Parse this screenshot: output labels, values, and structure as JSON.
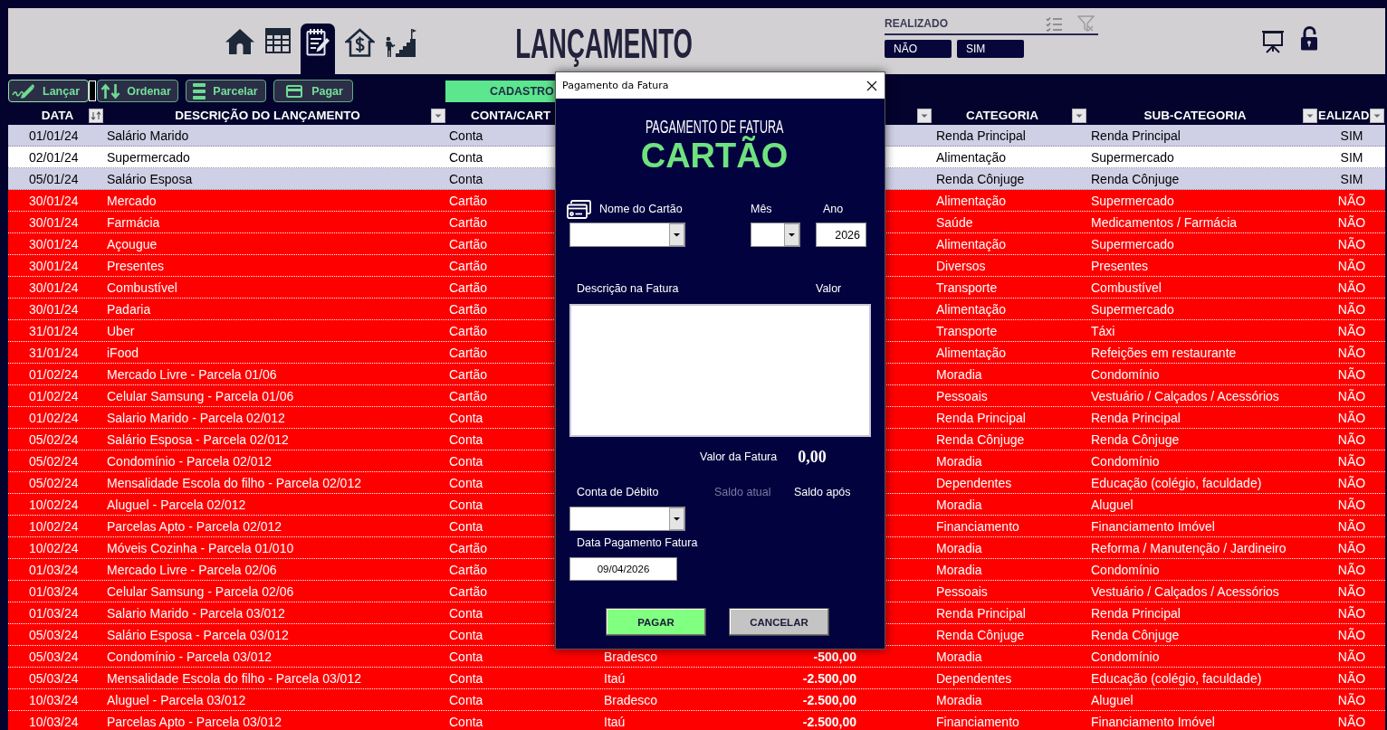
{
  "header": {
    "nav_tabs": [
      {
        "kind": "home",
        "selected": false
      },
      {
        "kind": "grid",
        "selected": false
      },
      {
        "kind": "notepad",
        "selected": true
      },
      {
        "kind": "house-dollar",
        "selected": false
      },
      {
        "kind": "stairs",
        "selected": false
      }
    ],
    "title": "LANÇAMENTO",
    "filter_panel": {
      "title": "REALIZADO",
      "options": [
        "NÃO",
        "SIM"
      ]
    }
  },
  "toolbar": {
    "buttons": [
      {
        "label": "Lançar",
        "kind": "signature"
      },
      {
        "label": "Ordenar",
        "kind": "sort"
      },
      {
        "label": "Parcelar",
        "kind": "stack"
      },
      {
        "label": "Pagar",
        "kind": "card"
      }
    ],
    "register_button": "CADASTRO"
  },
  "table": {
    "columns": [
      {
        "label": "DATA",
        "kind": "sort"
      },
      {
        "label": "DESCRIÇÃO DO LANÇAMENTO",
        "kind": "filter"
      },
      {
        "label": "CONTA/CART",
        "kind": "plain"
      },
      {
        "kind": "filter"
      },
      {
        "label": "CATEGORIA",
        "kind": "filter"
      },
      {
        "label": "SUB-CATEGORIA",
        "kind": "filter"
      },
      {
        "label": "EALIZAD",
        "kind": "filter"
      }
    ],
    "rows": [
      {
        "date": "01/01/24",
        "description": "Salário Marido",
        "column_3": "Conta",
        "category": "Renda Principal",
        "subcategory": "Renda Principal",
        "column_8": "SIM",
        "done": true
      },
      {
        "date": "02/01/24",
        "description": "Supermercado",
        "column_3": "Conta",
        "category": "Alimentação",
        "subcategory": "Supermercado",
        "column_8": "SIM",
        "done": true
      },
      {
        "date": "05/01/24",
        "description": "Salário Esposa",
        "column_3": "Conta",
        "category": "Renda Cônjuge",
        "subcategory": "Renda Cônjuge",
        "column_8": "SIM",
        "done": true
      },
      {
        "date": "30/01/24",
        "description": "Mercado",
        "column_3": "Cartão",
        "category": "Alimentação",
        "subcategory": "Supermercado",
        "column_8": "NÃO",
        "done": false
      },
      {
        "date": "30/01/24",
        "description": "Farmácia",
        "column_3": "Cartão",
        "category": "Saúde",
        "subcategory": "Medicamentos / Farmácia",
        "column_8": "NÃO",
        "done": false
      },
      {
        "date": "30/01/24",
        "description": "Açougue",
        "column_3": "Cartão",
        "category": "Alimentação",
        "subcategory": "Supermercado",
        "column_8": "NÃO",
        "done": false
      },
      {
        "date": "30/01/24",
        "description": "Presentes",
        "column_3": "Cartão",
        "category": "Diversos",
        "subcategory": "Presentes",
        "column_8": "NÃO",
        "done": false
      },
      {
        "date": "30/01/24",
        "description": "Combustível",
        "column_3": "Cartão",
        "category": "Transporte",
        "subcategory": "Combustível",
        "column_8": "NÃO",
        "done": false
      },
      {
        "date": "30/01/24",
        "description": "Padaria",
        "column_3": "Cartão",
        "category": "Alimentação",
        "subcategory": "Supermercado",
        "column_8": "NÃO",
        "done": false
      },
      {
        "date": "31/01/24",
        "description": "Uber",
        "column_3": "Cartão",
        "category": "Transporte",
        "subcategory": "Táxi",
        "column_8": "NÃO",
        "done": false
      },
      {
        "date": "31/01/24",
        "description": "iFood",
        "column_3": "Cartão",
        "category": "Alimentação",
        "subcategory": "Refeições em restaurante",
        "column_8": "NÃO",
        "done": false
      },
      {
        "date": "01/02/24",
        "description": "Mercado Livre - Parcela 01/06",
        "column_3": "Cartão",
        "category": "Moradia",
        "subcategory": "Condomínio",
        "column_8": "NÃO",
        "done": false
      },
      {
        "date": "01/02/24",
        "description": "Celular Samsung - Parcela 01/06",
        "column_3": "Cartão",
        "category": "Pessoais",
        "subcategory": "Vestuário / Calçados / Acessórios",
        "column_8": "NÃO",
        "done": false
      },
      {
        "date": "01/02/24",
        "description": "Salario Marido - Parcela 02/012",
        "column_3": "Conta",
        "category": "Renda Principal",
        "subcategory": "Renda Principal",
        "column_8": "NÃO",
        "done": false
      },
      {
        "date": "05/02/24",
        "description": "Salário Esposa - Parcela 02/012",
        "column_3": "Conta",
        "category": "Renda Cônjuge",
        "subcategory": "Renda Cônjuge",
        "column_8": "NÃO",
        "done": false
      },
      {
        "date": "05/02/24",
        "description": "Condomínio - Parcela 02/012",
        "column_3": "Conta",
        "category": "Moradia",
        "subcategory": "Condomínio",
        "column_8": "NÃO",
        "done": false
      },
      {
        "date": "05/02/24",
        "description": "Mensalidade Escola do filho - Parcela 02/012",
        "column_3": "Conta",
        "category": "Dependentes",
        "subcategory": "Educação (colégio, faculdade)",
        "column_8": "NÃO",
        "done": false
      },
      {
        "date": "10/02/24",
        "description": "Aluguel - Parcela 02/012",
        "column_3": "Conta",
        "category": "Moradia",
        "subcategory": "Aluguel",
        "column_8": "NÃO",
        "done": false
      },
      {
        "date": "10/02/24",
        "description": "Parcelas Apto - Parcela 02/012",
        "column_3": "Conta",
        "category": "Financiamento",
        "subcategory": "Financiamento Imóvel",
        "column_8": "NÃO",
        "done": false
      },
      {
        "date": "10/02/24",
        "description": "Móveis Cozinha - Parcela 01/010",
        "column_3": "Cartão",
        "category": "Moradia",
        "subcategory": "Reforma / Manutenção / Jardineiro",
        "column_8": "NÃO",
        "done": false
      },
      {
        "date": "01/03/24",
        "description": "Mercado Livre - Parcela 02/06",
        "column_3": "Cartão",
        "category": "Moradia",
        "subcategory": "Condomínio",
        "column_8": "NÃO",
        "done": false
      },
      {
        "date": "01/03/24",
        "description": "Celular Samsung - Parcela 02/06",
        "column_3": "Cartão",
        "category": "Pessoais",
        "subcategory": "Vestuário / Calçados / Acessórios",
        "column_8": "NÃO",
        "done": false
      },
      {
        "date": "01/03/24",
        "description": "Salario Marido - Parcela 03/012",
        "column_3": "Conta",
        "category": "Renda Principal",
        "subcategory": "Renda Principal",
        "column_8": "NÃO",
        "done": false
      },
      {
        "date": "05/03/24",
        "description": "Salário Esposa - Parcela 03/012",
        "column_3": "Conta",
        "category": "Renda Cônjuge",
        "subcategory": "Renda Cônjuge",
        "column_8": "NÃO",
        "done": false
      },
      {
        "date": "05/03/24",
        "description": "Condomínio - Parcela 03/012",
        "column_3": "Conta",
        "column_4": "Bradesco",
        "column_5": "-500,00",
        "category": "Moradia",
        "subcategory": "Condomínio",
        "column_8": "NÃO",
        "done": false
      },
      {
        "date": "05/03/24",
        "description": "Mensalidade Escola do filho - Parcela 03/012",
        "column_3": "Conta",
        "column_4": "Itaú",
        "column_5": "-2.500,00",
        "category": "Dependentes",
        "subcategory": "Educação (colégio, faculdade)",
        "column_8": "NÃO",
        "done": false
      },
      {
        "date": "10/03/24",
        "description": "Aluguel - Parcela 03/012",
        "column_3": "Conta",
        "column_4": "Bradesco",
        "column_5": "-2.500,00",
        "category": "Moradia",
        "subcategory": "Aluguel",
        "column_8": "NÃO",
        "done": false
      },
      {
        "date": "10/03/24",
        "description": "Parcelas Apto - Parcela 03/012",
        "column_3": "Conta",
        "column_4": "Itaú",
        "column_5": "-2.500,00",
        "category": "Financiamento",
        "subcategory": "Financiamento Imóvel",
        "column_8": "NÃO",
        "done": false
      }
    ]
  },
  "dialog": {
    "title": "Pagamento da Fatura",
    "heading": "PAGAMENTO DE FATURA",
    "subheading": "CARTÃO",
    "card_label": "Nome do Cartão",
    "month_label": "Mês",
    "year_label": "Ano",
    "year_value": "2026",
    "description_label": "Descrição na Fatura",
    "amount_label": "Valor",
    "total_label": "Valor da Fatura",
    "total_value": "0,00",
    "debit_account_label": "Conta de Débito",
    "balance_labels": [
      {
        "label": "Saldo atual",
        "disabled": true
      },
      {
        "label": "Saldo após",
        "disabled": false
      }
    ],
    "payment_date_label": "Data Pagamento Fatura",
    "payment_date_value": "09/04/2026",
    "buttons": [
      {
        "label": "PAGAR",
        "kind": "confirm"
      },
      {
        "label": "CANCELAR",
        "kind": "cancel"
      }
    ]
  }
}
